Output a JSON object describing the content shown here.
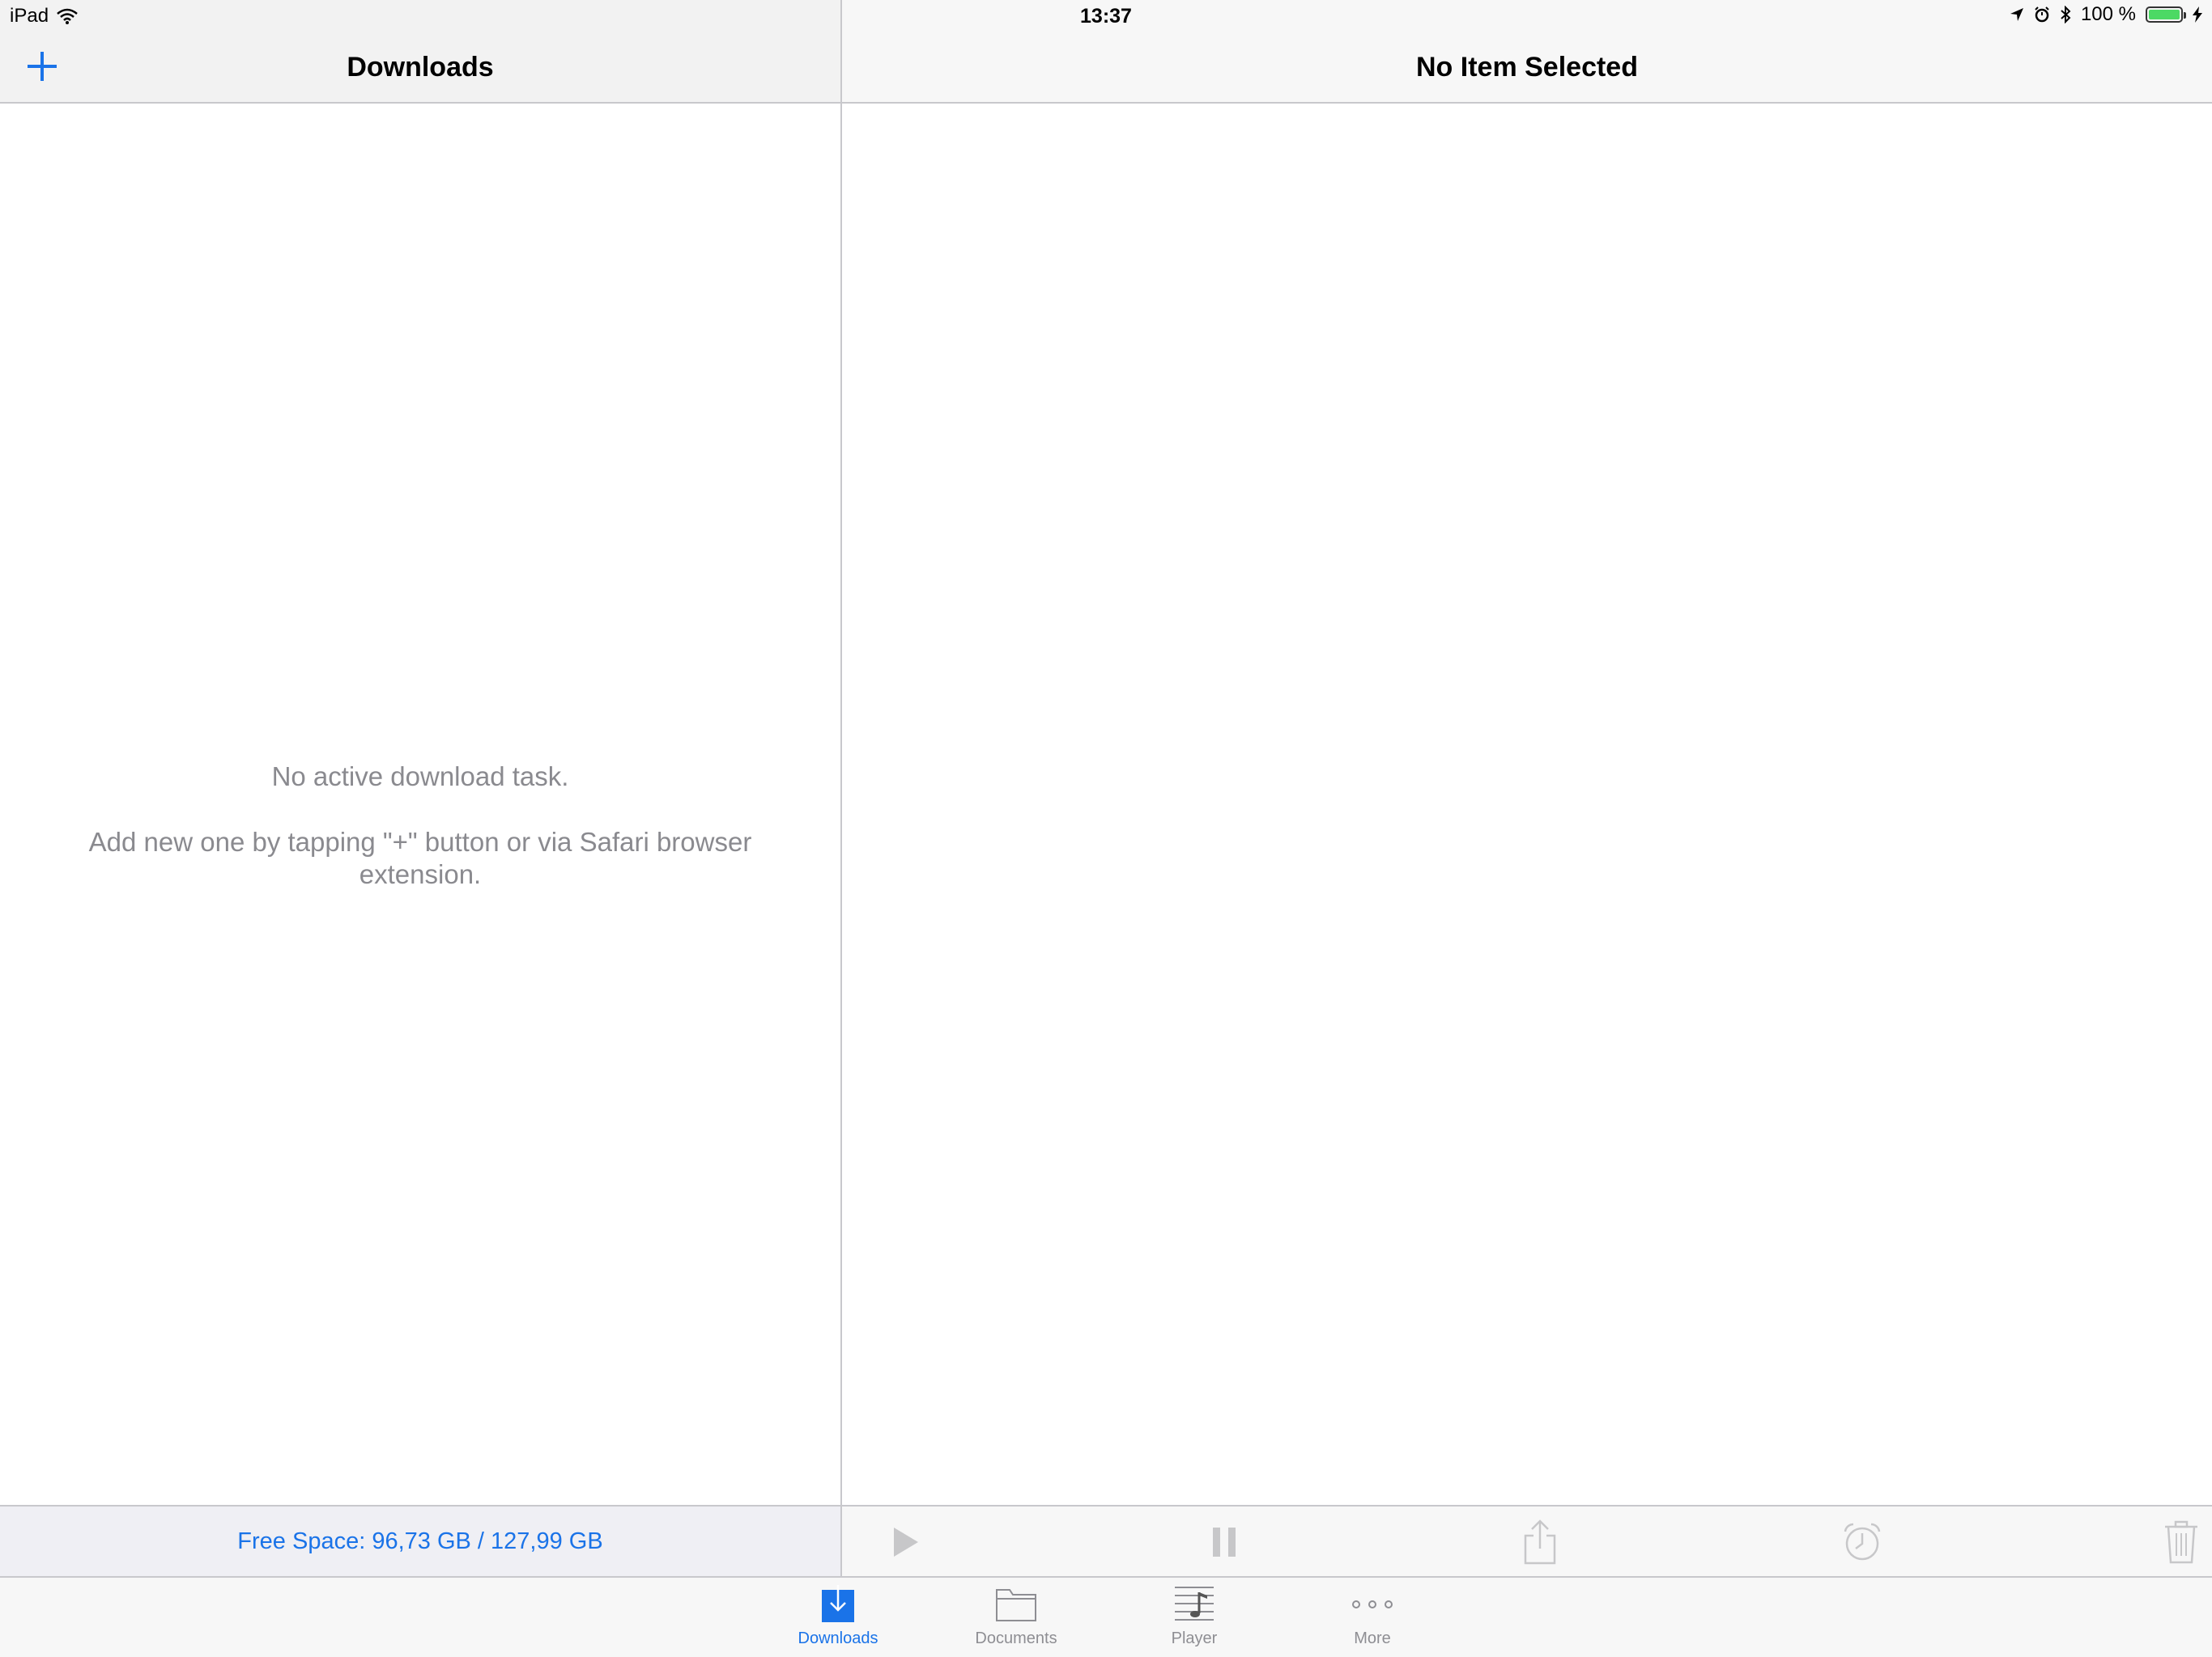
{
  "status_bar": {
    "device": "iPad",
    "time": "13:37",
    "battery_text": "100 %",
    "battery_level": 1.0,
    "icons": [
      "wifi-icon",
      "location-arrow-icon",
      "alarm-icon",
      "bluetooth-icon",
      "battery-icon",
      "charging-bolt-icon"
    ]
  },
  "left_pane": {
    "title": "Downloads",
    "add_icon": "plus-icon",
    "empty_message": "No active download task.",
    "empty_hint": "Add new one by tapping \"+\" button or via Safari browser extension.",
    "free_space": "Free Space: 96,73 GB / 127,99 GB"
  },
  "right_pane": {
    "title": "No Item Selected",
    "toolbar": [
      {
        "icon": "play-icon",
        "enabled": false
      },
      {
        "icon": "pause-icon",
        "enabled": false
      },
      {
        "icon": "share-icon",
        "enabled": false
      },
      {
        "icon": "alarm-clock-icon",
        "enabled": false
      },
      {
        "icon": "trash-icon",
        "enabled": false
      }
    ]
  },
  "tab_bar": {
    "tabs": [
      {
        "label": "Downloads",
        "icon": "download-icon",
        "active": true
      },
      {
        "label": "Documents",
        "icon": "folder-icon",
        "active": false
      },
      {
        "label": "Player",
        "icon": "music-player-icon",
        "active": false
      },
      {
        "label": "More",
        "icon": "more-dots-icon",
        "active": false
      }
    ]
  },
  "colors": {
    "accent": "#1a73e8",
    "battery_green": "#4cd964",
    "secondary_text": "#8a8a8f",
    "separator": "#c8c8cc"
  }
}
